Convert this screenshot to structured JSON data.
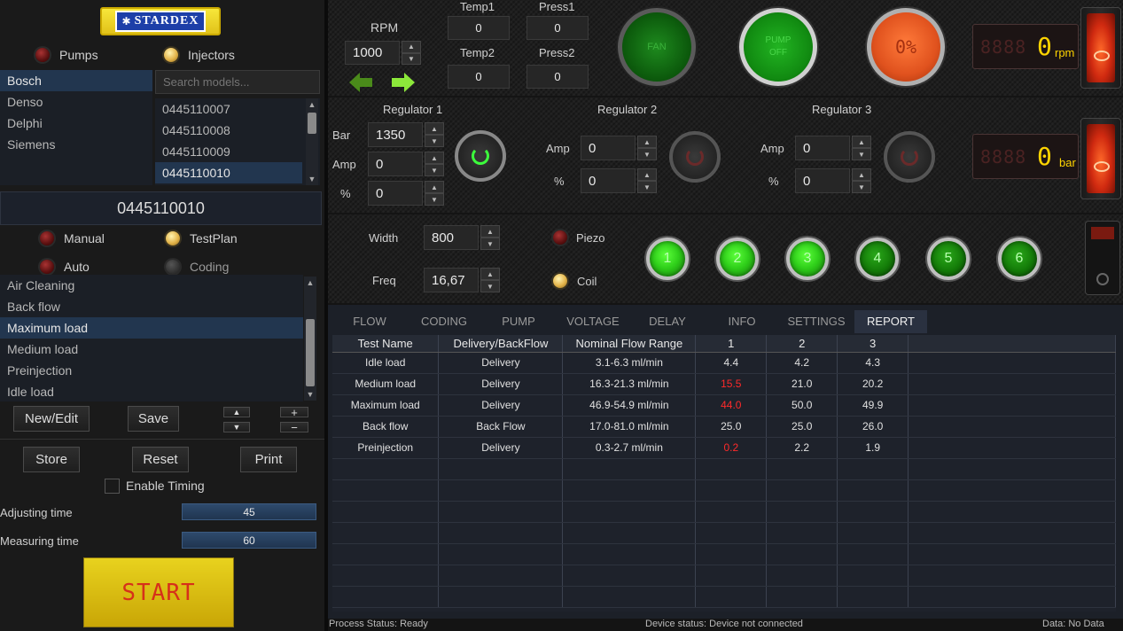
{
  "brand": "STARDEX",
  "mode": {
    "pumps": "Pumps",
    "injectors": "Injectors"
  },
  "manufacturers": [
    "Bosch",
    "Denso",
    "Delphi",
    "Siemens"
  ],
  "search": {
    "placeholder": "Search models..."
  },
  "models": [
    "0445110007",
    "0445110008",
    "0445110009",
    "0445110010"
  ],
  "selected_model": "0445110010",
  "run_modes": {
    "manual": "Manual",
    "testplan": "TestPlan",
    "auto": "Auto",
    "coding": "Coding"
  },
  "tests": [
    "Air Cleaning",
    "Back flow",
    "Maximum load",
    "Medium load",
    "Preinjection",
    "Idle load"
  ],
  "test_buttons": {
    "new_edit": "New/Edit",
    "save": "Save",
    "plus": "+",
    "minus": "−"
  },
  "actions": {
    "store": "Store",
    "reset": "Reset",
    "print": "Print"
  },
  "timing": {
    "enable_label": "Enable Timing",
    "adjust_label": "Adjusting time",
    "adjust_value": "45",
    "measure_label": "Measuring time",
    "measure_value": "60"
  },
  "start_label": "START",
  "rpm": {
    "label": "RPM",
    "value": "1000"
  },
  "sensors": {
    "temp1_label": "Temp1",
    "temp1": "0",
    "press1_label": "Press1",
    "press1": "0",
    "temp2_label": "Temp2",
    "temp2": "0",
    "press2_label": "Press2",
    "press2": "0"
  },
  "fan_label": "FAN",
  "pump_label_1": "PUMP",
  "pump_label_2": "OFF",
  "percent_label": "0%",
  "rpm_display": {
    "value": "0",
    "unit": "rpm"
  },
  "bar_display": {
    "value": "0",
    "unit": "bar"
  },
  "regulator1": {
    "title": "Regulator 1",
    "bar_label": "Bar",
    "bar": "1350",
    "amp_label": "Amp",
    "amp": "0",
    "pct_label": "%",
    "pct": "0"
  },
  "regulator2": {
    "title": "Regulator 2",
    "amp_label": "Amp",
    "amp": "0",
    "pct_label": "%",
    "pct": "0"
  },
  "regulator3": {
    "title": "Regulator 3",
    "amp_label": "Amp",
    "amp": "0",
    "pct_label": "%",
    "pct": "0"
  },
  "pulse": {
    "width_label": "Width",
    "width": "800",
    "freq_label": "Freq",
    "freq": "16,67",
    "piezo": "Piezo",
    "coil": "Coil"
  },
  "channels": [
    "1",
    "2",
    "3",
    "4",
    "5",
    "6"
  ],
  "tabs": [
    "FLOW",
    "CODING",
    "PUMP",
    "VOLTAGE",
    "DELAY",
    "INFO",
    "SETTINGS",
    "REPORT"
  ],
  "report": {
    "headers": [
      "Test Name",
      "Delivery/BackFlow",
      "Nominal Flow Range",
      "1",
      "2",
      "3"
    ],
    "rows": [
      [
        "Idle load",
        "Delivery",
        "3.1-6.3 ml/min",
        "4.4",
        "4.2",
        "4.3"
      ],
      [
        "Medium load",
        "Delivery",
        "16.3-21.3 ml/min",
        "15.5",
        "21.0",
        "20.2"
      ],
      [
        "Maximum load",
        "Delivery",
        "46.9-54.9 ml/min",
        "44.0",
        "50.0",
        "49.9"
      ],
      [
        "Back flow",
        "Back Flow",
        "17.0-81.0 ml/min",
        "25.0",
        "25.0",
        "26.0"
      ],
      [
        "Preinjection",
        "Delivery",
        "0.3-2.7 ml/min",
        "0.2",
        "2.2",
        "1.9"
      ]
    ]
  },
  "status": {
    "process": "Process Status: Ready",
    "device": "Device status: Device not connected",
    "data": "Data: No Data"
  },
  "colors": {
    "accent_blue": "#22364f",
    "led_green": "#2fcf1a",
    "warning_red": "#ff2a2a",
    "start_yellow": "#e1c21a"
  }
}
